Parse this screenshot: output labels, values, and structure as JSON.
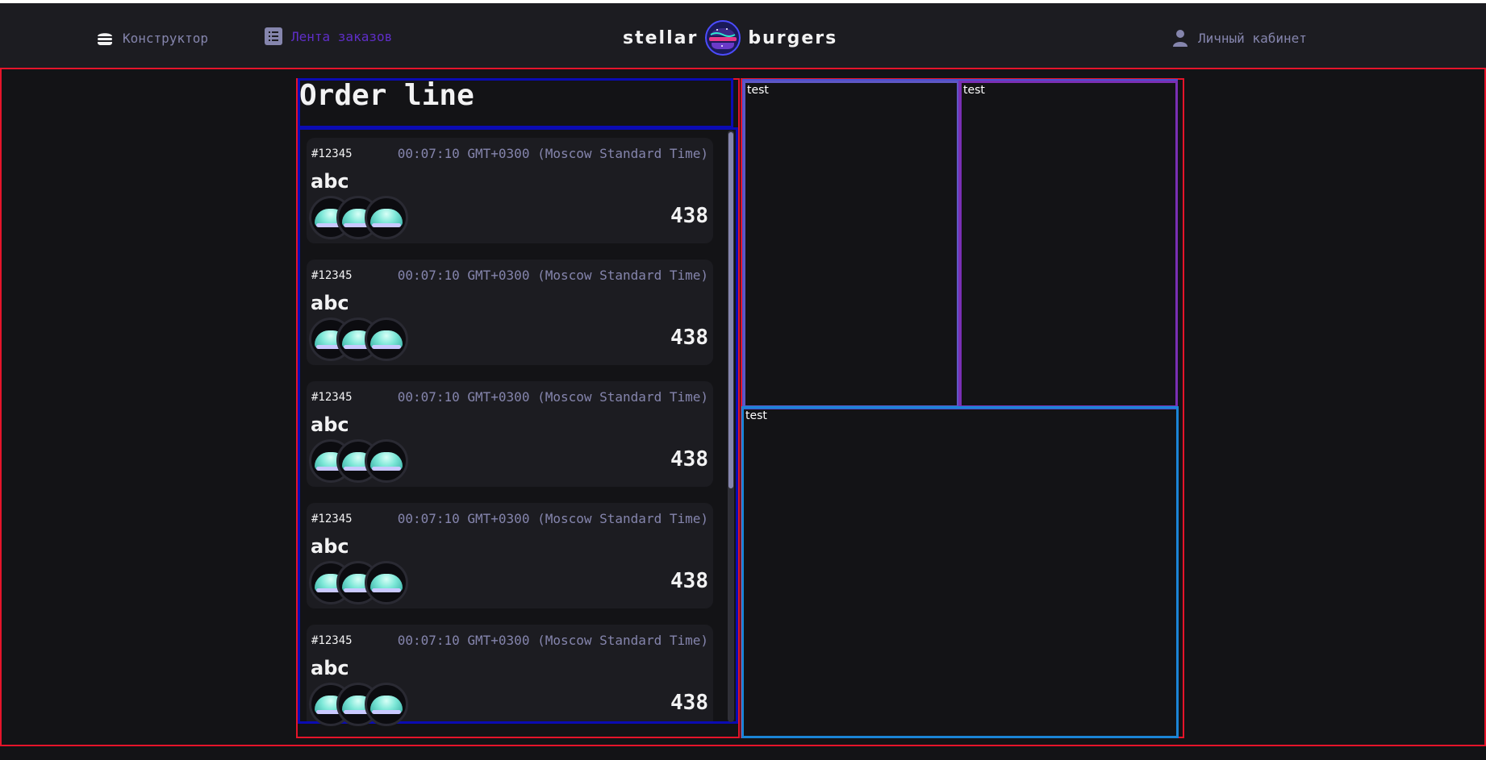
{
  "header": {
    "nav": {
      "constructor_label": "Конструктор",
      "feed_label": "Лента заказов",
      "profile_label": "Личный кабинет"
    },
    "logo": {
      "left_text": "stellar",
      "right_text": "burgers"
    }
  },
  "orders": {
    "title": "Order line",
    "items": [
      {
        "number": "#12345",
        "date": "00:07:10 GMT+0300 (Moscow Standard Time)",
        "name": "abc",
        "price": "438"
      },
      {
        "number": "#12345",
        "date": "00:07:10 GMT+0300 (Moscow Standard Time)",
        "name": "abc",
        "price": "438"
      },
      {
        "number": "#12345",
        "date": "00:07:10 GMT+0300 (Moscow Standard Time)",
        "name": "abc",
        "price": "438"
      },
      {
        "number": "#12345",
        "date": "00:07:10 GMT+0300 (Moscow Standard Time)",
        "name": "abc",
        "price": "438"
      },
      {
        "number": "#12345",
        "date": "00:07:10 GMT+0300 (Moscow Standard Time)",
        "name": "abc",
        "price": "438"
      }
    ]
  },
  "info": {
    "panels": [
      "test",
      "test",
      "test"
    ]
  },
  "colors": {
    "background": "#131316",
    "header": "#1c1c21",
    "card": "#1c1c21",
    "accent_text": "#8585ad",
    "active_nav": "#5f2ec8",
    "frame_red": "#e5142a",
    "frame_blue": "#0b0bb3"
  },
  "icons": {
    "constructor": "burger-icon",
    "feed": "list-icon",
    "profile": "user-icon"
  }
}
